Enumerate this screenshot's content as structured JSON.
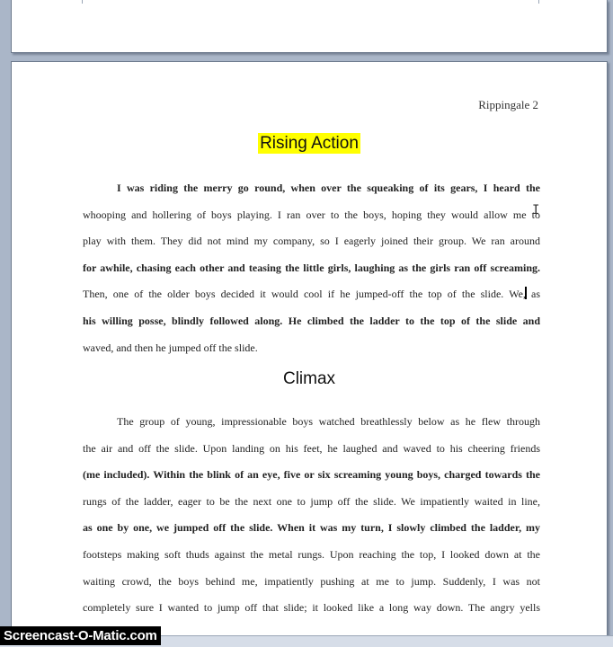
{
  "document": {
    "running_header": "Rippingale 2",
    "sections": [
      {
        "heading": "Rising Action",
        "highlight_color": "#ffff00",
        "lines": [
          "I was riding the merry go round, when over the squeaking of its gears, I heard the",
          "whooping and hollering of boys playing. I ran over to the boys, hoping they would allow me to",
          "play with them. They did not mind my company, so I eagerly joined their group. We ran around",
          "for awhile, chasing each other and teasing the little girls, laughing as the girls ran off screaming.",
          "Then, one of the older boys decided it would cool if he jumped-off the top of the slide. We, as",
          "his willing posse, blindly followed along. He climbed the ladder to the top of the slide and",
          "waved, and then he jumped off the slide."
        ]
      },
      {
        "heading": "Climax",
        "lines": [
          "The group of young, impressionable boys watched breathlessly below as he flew through",
          "the air and off the slide. Upon landing on his feet, he laughed and waved to his cheering friends",
          "(me included). Within the blink of an eye, five or six screaming young boys, charged towards the",
          "rungs of the ladder, eager to be the next one to jump off the slide. We impatiently waited in line,",
          "as one by one, we jumped off the slide. When it was my turn, I slowly climbed the ladder, my",
          "footsteps making soft thuds against the metal rungs. Upon reaching the top, I looked down at the",
          "waiting crowd, the boys behind me, impatiently pushing at me to jump. Suddenly, I was not",
          "completely sure I wanted to jump off that slide; it looked like a long way down. The angry yells"
        ]
      }
    ]
  },
  "watermark": "Screencast-O-Matic.com",
  "cursor_icon": "text-ibeam-icon"
}
